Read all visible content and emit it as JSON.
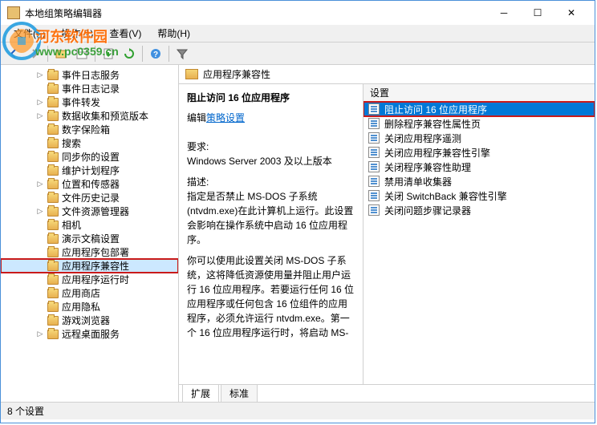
{
  "window": {
    "title": "本地组策略编辑器"
  },
  "menubar": {
    "file": "文件(F)",
    "action": "操作(A)",
    "view": "查看(V)",
    "help": "帮助(H)"
  },
  "tree": {
    "items": [
      {
        "label": "事件日志服务",
        "hasChildren": true
      },
      {
        "label": "事件日志记录"
      },
      {
        "label": "事件转发",
        "hasChildren": true
      },
      {
        "label": "数据收集和预览版本",
        "hasChildren": true
      },
      {
        "label": "数字保险箱"
      },
      {
        "label": "搜索"
      },
      {
        "label": "同步你的设置"
      },
      {
        "label": "维护计划程序"
      },
      {
        "label": "位置和传感器",
        "hasChildren": true
      },
      {
        "label": "文件历史记录"
      },
      {
        "label": "文件资源管理器",
        "hasChildren": true
      },
      {
        "label": "相机"
      },
      {
        "label": "演示文稿设置"
      },
      {
        "label": "应用程序包部署"
      },
      {
        "label": "应用程序兼容性",
        "selected": true,
        "boxed": true
      },
      {
        "label": "应用程序运行时"
      },
      {
        "label": "应用商店"
      },
      {
        "label": "应用隐私"
      },
      {
        "label": "游戏浏览器"
      },
      {
        "label": "远程桌面服务",
        "hasChildren": true
      }
    ]
  },
  "main": {
    "header": "应用程序兼容性",
    "desc": {
      "title": "阻止访问 16 位应用程序",
      "edit_link_label": "策略设置",
      "edit_prefix": "编辑",
      "req_label": "要求:",
      "req_value": "Windows Server 2003 及以上版本",
      "desc_label": "描述:",
      "desc_p1": "指定是否禁止 MS-DOS 子系统(ntvdm.exe)在此计算机上运行。此设置会影响在操作系统中启动 16 位应用程序。",
      "desc_p2": "你可以使用此设置关闭 MS-DOS 子系统，这将降低资源使用量并阻止用户运行 16 位应用程序。若要运行任何 16 位应用程序或任何包含 16 位组件的应用程序，必须允许运行 ntvdm.exe。第一个 16 位应用程序运行时，将启动 MS-"
    },
    "list_header": "设置",
    "settings": [
      {
        "label": "阻止访问 16 位应用程序",
        "selected": true,
        "boxed": true
      },
      {
        "label": "删除程序兼容性属性页"
      },
      {
        "label": "关闭应用程序遥测"
      },
      {
        "label": "关闭应用程序兼容性引擎"
      },
      {
        "label": "关闭程序兼容性助理"
      },
      {
        "label": "禁用清单收集器"
      },
      {
        "label": "关闭 SwitchBack 兼容性引擎"
      },
      {
        "label": "关闭问题步骤记录器"
      }
    ],
    "tabs": {
      "extended": "扩展",
      "standard": "标准"
    }
  },
  "statusbar": {
    "text": "8 个设置"
  },
  "watermark": {
    "text": "河东软件园",
    "url": "www.pc0359.cn"
  }
}
